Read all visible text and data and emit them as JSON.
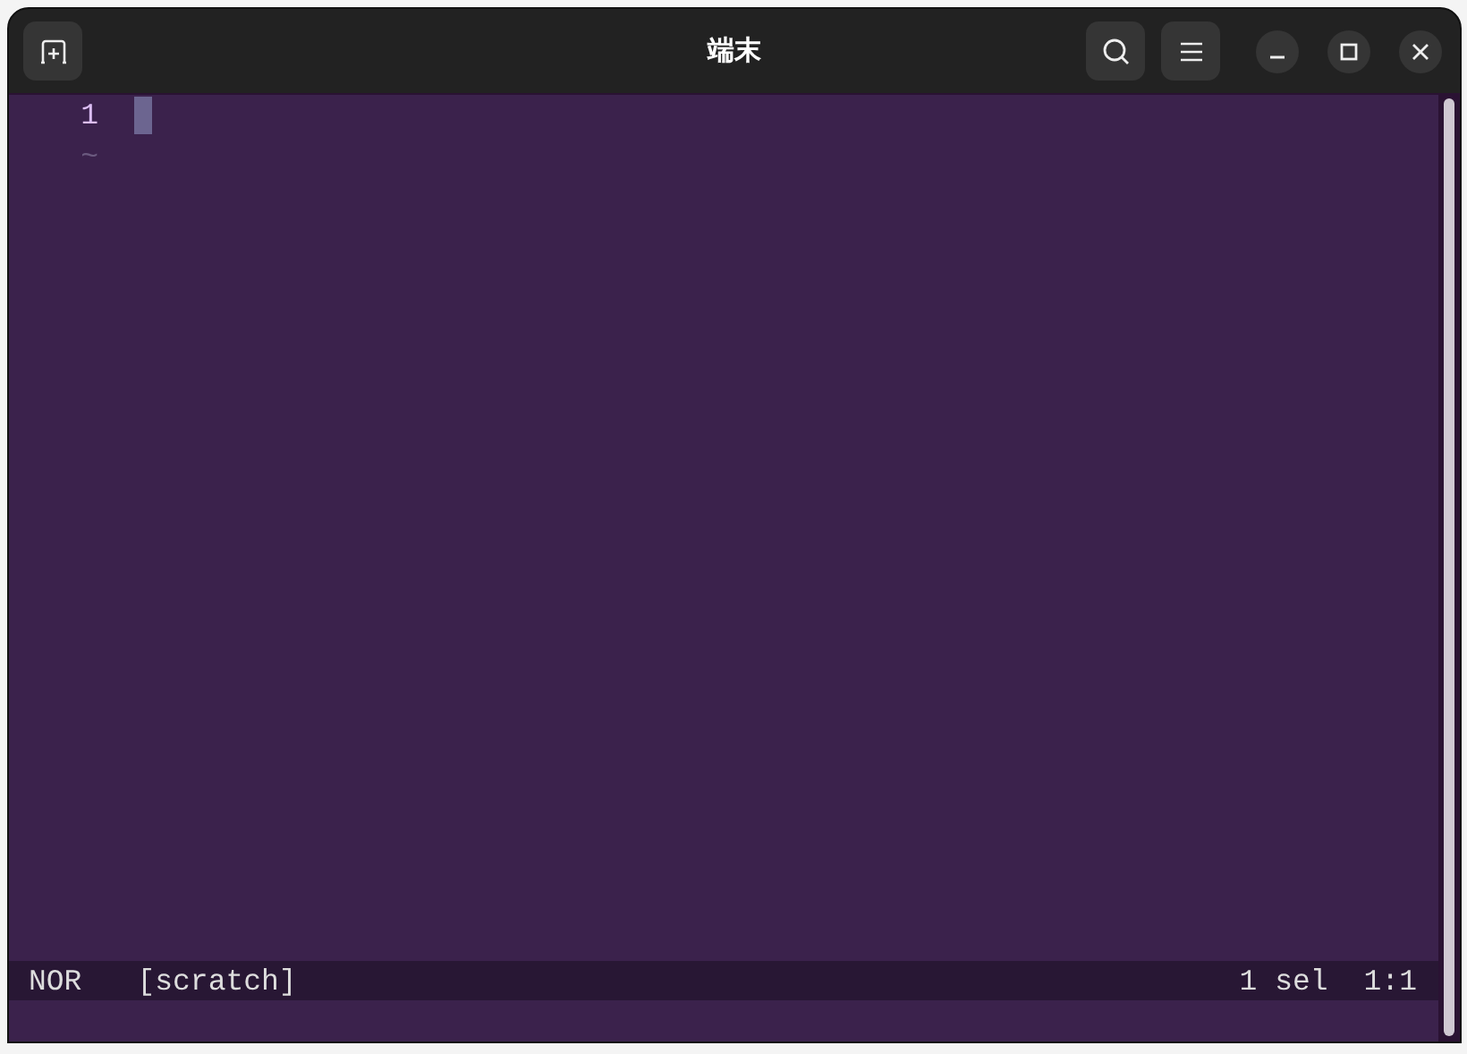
{
  "window": {
    "title": "端末"
  },
  "editor": {
    "lines": [
      {
        "number": "1"
      }
    ],
    "filler": [
      "~"
    ]
  },
  "status_bar": {
    "mode": "NOR",
    "buffer": "[scratch]",
    "selections": "1 sel",
    "position": "1:1"
  }
}
